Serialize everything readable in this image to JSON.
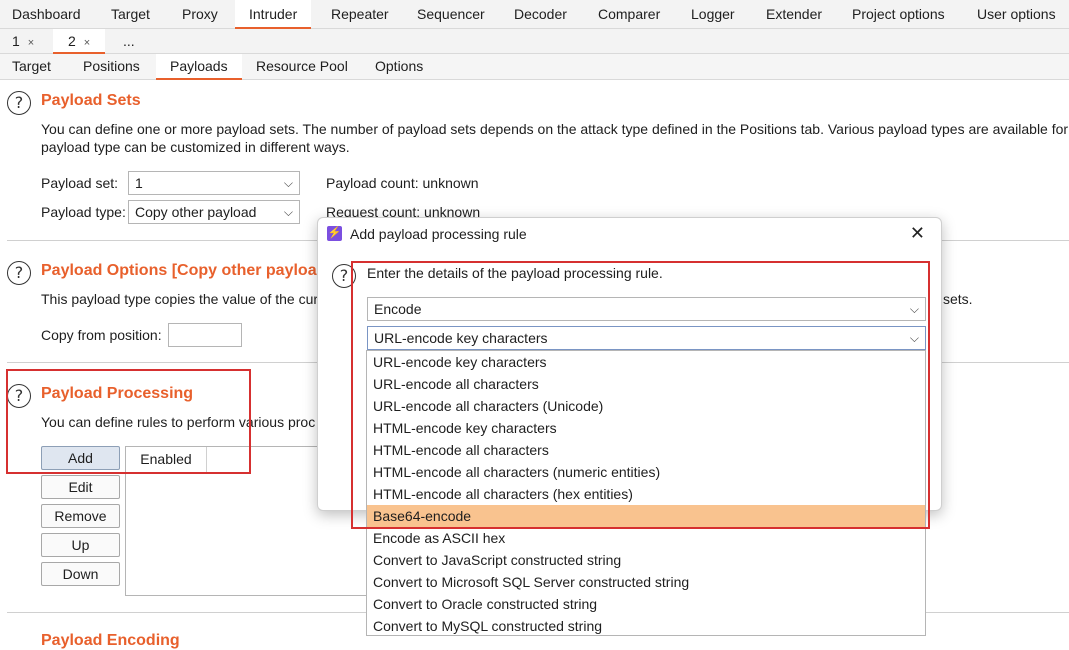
{
  "top_tabs": [
    "Dashboard",
    "Target",
    "Proxy",
    "Intruder",
    "Repeater",
    "Sequencer",
    "Decoder",
    "Comparer",
    "Logger",
    "Extender",
    "Project options",
    "User options"
  ],
  "attack_tabs": [
    "1",
    "2",
    "..."
  ],
  "close_glyph": "×",
  "config_tabs": [
    "Target",
    "Positions",
    "Payloads",
    "Resource Pool",
    "Options"
  ],
  "help_glyph": "?",
  "payload_sets": {
    "title": "Payload Sets",
    "desc_line1": "You can define one or more payload sets. The number of payload sets depends on the attack type defined in the Positions tab. Various payload types are available for e",
    "desc_line2": "payload type can be customized in different ways.",
    "set_label": "Payload set:",
    "set_value": "1",
    "type_label": "Payload type:",
    "type_value": "Copy other payload",
    "count_text": "Payload count: unknown",
    "request_text": "Request count: unknown"
  },
  "payload_options": {
    "title": "Payload Options [Copy other payloa",
    "desc_left": "This payload type copies the value of the cur",
    "desc_right": "sets.",
    "copy_label": "Copy from position:",
    "copy_value": ""
  },
  "payload_processing": {
    "title": "Payload Processing",
    "desc": "You can define rules to perform various proc",
    "buttons": [
      "Add",
      "Edit",
      "Remove",
      "Up",
      "Down"
    ],
    "table_header": "Enabled"
  },
  "payload_encoding": {
    "title": "Payload Encoding"
  },
  "dialog": {
    "icon_glyph": "⚡",
    "title": "Add payload processing rule",
    "close_glyph": "✕",
    "prompt": "Enter the details of the payload processing rule.",
    "rule_type": "Encode",
    "encoding": "URL-encode key characters",
    "chevron": "⌵",
    "options": [
      "URL-encode key characters",
      "URL-encode all characters",
      "URL-encode all characters (Unicode)",
      "HTML-encode key characters",
      "HTML-encode all characters",
      "HTML-encode all characters (numeric entities)",
      "HTML-encode all characters (hex entities)",
      "Base64-encode",
      "Encode as ASCII hex",
      "Convert to JavaScript constructed string",
      "Convert to Microsoft SQL Server constructed string",
      "Convert to Oracle constructed string",
      "Convert to MySQL constructed string"
    ],
    "selected_option": "Base64-encode"
  },
  "colors": {
    "accent": "#e8602c",
    "highlight": "#f9c38f",
    "annotation": "#d63030"
  }
}
